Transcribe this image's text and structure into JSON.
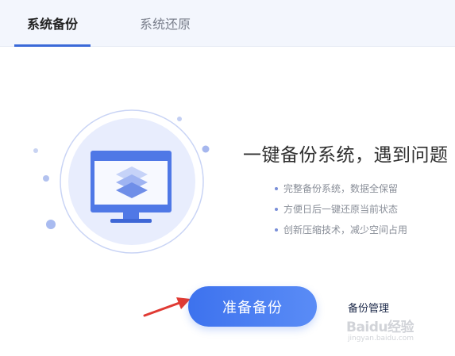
{
  "tabs": {
    "backup_label": "系统备份",
    "restore_label": "系统还原"
  },
  "hero": {
    "headline": "一键备份系统，遇到问题"
  },
  "features": [
    "完整备份系统，数据全保留",
    "方便日后一键还原当前状态",
    "创新压缩技术，减少空间占用"
  ],
  "actions": {
    "prepare_backup_label": "准备备份",
    "manage_backup_label": "备份管理"
  },
  "watermark": {
    "main": "Baidu经验",
    "sub": "jingyan.baidu.com"
  },
  "colors": {
    "accent": "#3a69d8",
    "button_start": "#3d72ee",
    "button_end": "#5a8cf6",
    "annotation_arrow": "#e03a33"
  }
}
